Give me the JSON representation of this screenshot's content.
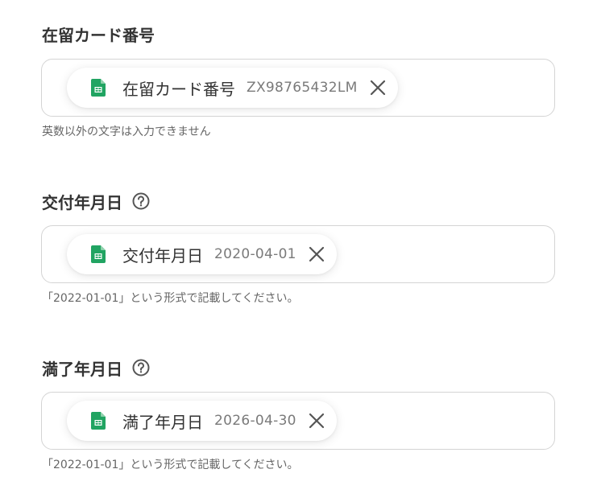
{
  "fields": [
    {
      "label": "在留カード番号",
      "has_help": false,
      "chip": {
        "icon": "google-sheets-icon",
        "label": "在留カード番号",
        "value": "ZX98765432LM"
      },
      "hint": "英数以外の文字は入力できません"
    },
    {
      "label": "交付年月日",
      "has_help": true,
      "chip": {
        "icon": "google-sheets-icon",
        "label": "交付年月日",
        "value": "2020-04-01"
      },
      "hint": "「2022-01-01」という形式で記載してください。"
    },
    {
      "label": "満了年月日",
      "has_help": true,
      "chip": {
        "icon": "google-sheets-icon",
        "label": "満了年月日",
        "value": "2026-04-30"
      },
      "hint": "「2022-01-01」という形式で記載してください。"
    }
  ],
  "colors": {
    "sheets_green": "#21a462",
    "label_text": "#333333",
    "value_text": "#7a7a7a",
    "border": "#d4d4d4"
  }
}
